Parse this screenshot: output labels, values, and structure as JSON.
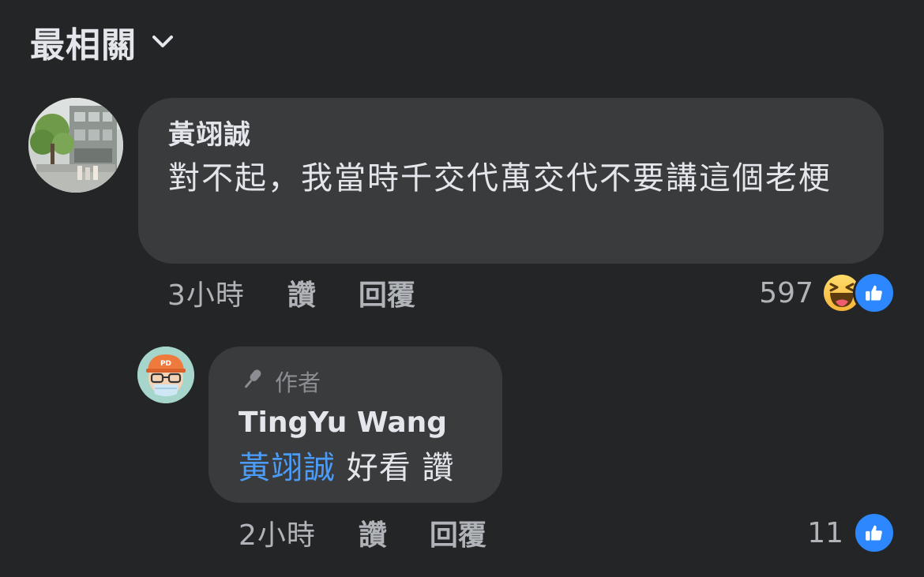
{
  "header": {
    "sort_label": "最相關",
    "chevron_icon": "chevron-down-icon"
  },
  "comments": [
    {
      "author": "黃翊誠",
      "text": "對不起，我當時千交代萬交代不要講這個老梗",
      "time": "3小時",
      "like_label": "讚",
      "reply_label": "回覆",
      "reaction_count": "597",
      "reactions": [
        "haha-icon",
        "like-icon"
      ]
    }
  ],
  "reply": {
    "badge_label": "作者",
    "badge_icon": "microphone-icon",
    "author": "TingYu Wang",
    "mention": "黃翊誠",
    "text": " 好看 讚",
    "time": "2小時",
    "like_label": "讚",
    "reply_label": "回覆",
    "reaction_count": "11",
    "reactions": [
      "like-icon"
    ]
  },
  "colors": {
    "background": "#242527",
    "bubble": "#3a3b3c",
    "mention": "#4b9bf9",
    "like_blue": "#2d88ff",
    "secondary_text": "#b0b3b8"
  }
}
